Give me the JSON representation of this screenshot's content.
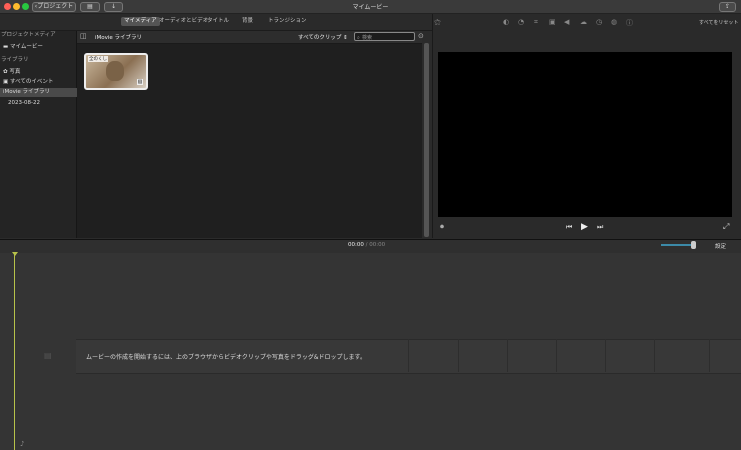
{
  "window": {
    "title": "マイムービー"
  },
  "toolbar": {
    "back_label": "プロジェクト"
  },
  "tabs": [
    {
      "label": "マイメディア",
      "active": true
    },
    {
      "label": "オーディオとビデオ",
      "active": false
    },
    {
      "label": "タイトル",
      "active": false
    },
    {
      "label": "背景",
      "active": false
    },
    {
      "label": "トランジション",
      "active": false
    }
  ],
  "sidebar": {
    "project_media_header": "プロジェクトメディア",
    "project_item": "マイムービー",
    "library_header": "ライブラリ",
    "items": [
      "写真",
      "すべてのイベント",
      "iMovie ライブラリ",
      "2023-08-22"
    ]
  },
  "browser": {
    "title": "iMovie ライブラリ",
    "filter": "すべてのクリップ",
    "search_placeholder": "検索",
    "clip_badge": "全のくし"
  },
  "viewer": {
    "reset_all": "すべてをリセット"
  },
  "timeline": {
    "current_time": "00:00",
    "separator": "/",
    "total_time": "00:00",
    "settings_label": "設定",
    "hint": "ムービーの作成を開始するには、上のブラウザからビデオクリップや写真をドラッグ&ドロップします。"
  },
  "colors": {
    "playhead": "#b7c24a",
    "zoom_slider": "#3c8aa8"
  }
}
